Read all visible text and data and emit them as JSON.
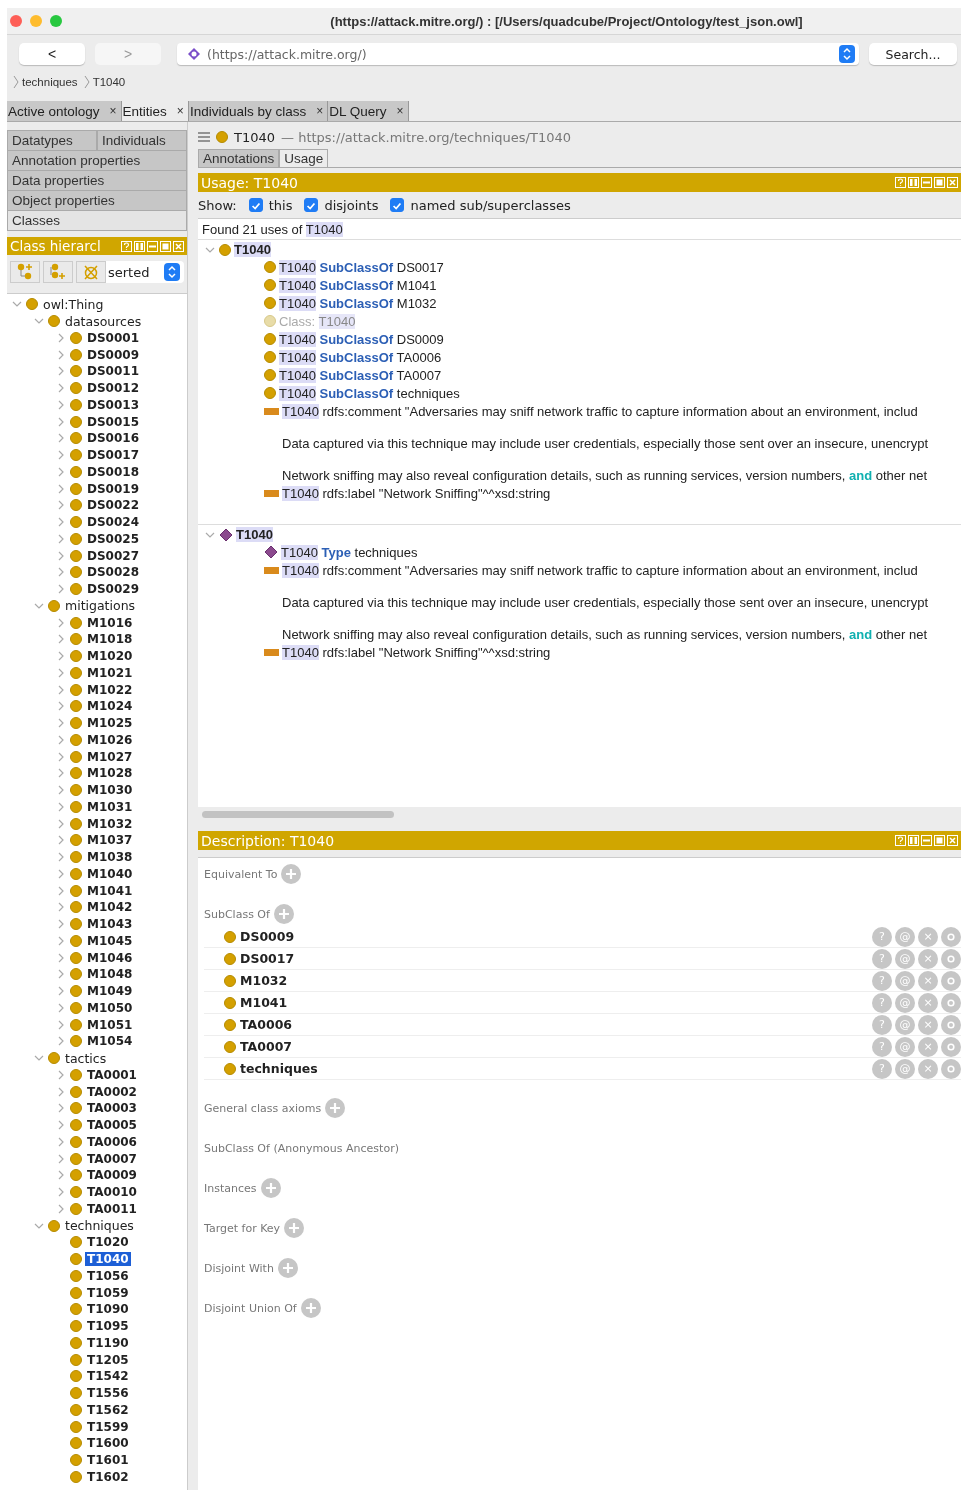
{
  "window": {
    "title": "(https://attack.mitre.org/)  : [/Users/quadcube/Project/Ontology/test_json.owl]"
  },
  "toolbar": {
    "back": "<",
    "forward": ">",
    "forward_disabled": true,
    "address": "(https://attack.mitre.org/)",
    "search": "Search..."
  },
  "breadcrumb": [
    "techniques",
    "T1040"
  ],
  "tabs": [
    {
      "label": "Active ontology",
      "close": "×",
      "selected": false
    },
    {
      "label": "Entities",
      "close": "×",
      "selected": true
    },
    {
      "label": "Individuals by class",
      "close": "×",
      "selected": false
    },
    {
      "label": "DL Query",
      "close": "×",
      "selected": false
    }
  ],
  "entity_tabs": [
    {
      "label": "Datatypes",
      "selected": false
    },
    {
      "label": "Individuals",
      "selected": false
    },
    {
      "label": "Annotation properties",
      "selected": false
    },
    {
      "label": "Data properties",
      "selected": false
    },
    {
      "label": "Object properties",
      "selected": false
    },
    {
      "label": "Classes",
      "selected": true
    }
  ],
  "class_hierarchy": {
    "title": "Class hierarcl",
    "mode": "serted",
    "tree": [
      {
        "label": "owl:Thing",
        "kind": "branch",
        "expanded": true,
        "selected": false,
        "children": [
          {
            "label": "datasources",
            "kind": "branch",
            "expanded": true,
            "selected": false,
            "children": [
              {
                "label": "DS0001",
                "kind": "branch",
                "expanded": false,
                "selected": false
              },
              {
                "label": "DS0009",
                "kind": "branch",
                "expanded": false,
                "selected": false
              },
              {
                "label": "DS0011",
                "kind": "branch",
                "expanded": false,
                "selected": false
              },
              {
                "label": "DS0012",
                "kind": "branch",
                "expanded": false,
                "selected": false
              },
              {
                "label": "DS0013",
                "kind": "branch",
                "expanded": false,
                "selected": false
              },
              {
                "label": "DS0015",
                "kind": "branch",
                "expanded": false,
                "selected": false
              },
              {
                "label": "DS0016",
                "kind": "branch",
                "expanded": false,
                "selected": false
              },
              {
                "label": "DS0017",
                "kind": "branch",
                "expanded": false,
                "selected": false
              },
              {
                "label": "DS0018",
                "kind": "branch",
                "expanded": false,
                "selected": false
              },
              {
                "label": "DS0019",
                "kind": "branch",
                "expanded": false,
                "selected": false
              },
              {
                "label": "DS0022",
                "kind": "branch",
                "expanded": false,
                "selected": false
              },
              {
                "label": "DS0024",
                "kind": "branch",
                "expanded": false,
                "selected": false
              },
              {
                "label": "DS0025",
                "kind": "branch",
                "expanded": false,
                "selected": false
              },
              {
                "label": "DS0027",
                "kind": "branch",
                "expanded": false,
                "selected": false
              },
              {
                "label": "DS0028",
                "kind": "branch",
                "expanded": false,
                "selected": false
              },
              {
                "label": "DS0029",
                "kind": "branch",
                "expanded": false,
                "selected": false
              }
            ]
          },
          {
            "label": "mitigations",
            "kind": "branch",
            "expanded": true,
            "selected": false,
            "children": [
              {
                "label": "M1016",
                "kind": "branch",
                "expanded": false,
                "selected": false
              },
              {
                "label": "M1018",
                "kind": "branch",
                "expanded": false,
                "selected": false
              },
              {
                "label": "M1020",
                "kind": "branch",
                "expanded": false,
                "selected": false
              },
              {
                "label": "M1021",
                "kind": "branch",
                "expanded": false,
                "selected": false
              },
              {
                "label": "M1022",
                "kind": "branch",
                "expanded": false,
                "selected": false
              },
              {
                "label": "M1024",
                "kind": "branch",
                "expanded": false,
                "selected": false
              },
              {
                "label": "M1025",
                "kind": "branch",
                "expanded": false,
                "selected": false
              },
              {
                "label": "M1026",
                "kind": "branch",
                "expanded": false,
                "selected": false
              },
              {
                "label": "M1027",
                "kind": "branch",
                "expanded": false,
                "selected": false
              },
              {
                "label": "M1028",
                "kind": "branch",
                "expanded": false,
                "selected": false
              },
              {
                "label": "M1030",
                "kind": "branch",
                "expanded": false,
                "selected": false
              },
              {
                "label": "M1031",
                "kind": "branch",
                "expanded": false,
                "selected": false
              },
              {
                "label": "M1032",
                "kind": "branch",
                "expanded": false,
                "selected": false
              },
              {
                "label": "M1037",
                "kind": "branch",
                "expanded": false,
                "selected": false
              },
              {
                "label": "M1038",
                "kind": "branch",
                "expanded": false,
                "selected": false
              },
              {
                "label": "M1040",
                "kind": "branch",
                "expanded": false,
                "selected": false
              },
              {
                "label": "M1041",
                "kind": "branch",
                "expanded": false,
                "selected": false
              },
              {
                "label": "M1042",
                "kind": "branch",
                "expanded": false,
                "selected": false
              },
              {
                "label": "M1043",
                "kind": "branch",
                "expanded": false,
                "selected": false
              },
              {
                "label": "M1045",
                "kind": "branch",
                "expanded": false,
                "selected": false
              },
              {
                "label": "M1046",
                "kind": "branch",
                "expanded": false,
                "selected": false
              },
              {
                "label": "M1048",
                "kind": "branch",
                "expanded": false,
                "selected": false
              },
              {
                "label": "M1049",
                "kind": "branch",
                "expanded": false,
                "selected": false
              },
              {
                "label": "M1050",
                "kind": "branch",
                "expanded": false,
                "selected": false
              },
              {
                "label": "M1051",
                "kind": "branch",
                "expanded": false,
                "selected": false
              },
              {
                "label": "M1054",
                "kind": "branch",
                "expanded": false,
                "selected": false
              }
            ]
          },
          {
            "label": "tactics",
            "kind": "branch",
            "expanded": true,
            "selected": false,
            "children": [
              {
                "label": "TA0001",
                "kind": "branch",
                "expanded": false,
                "selected": false
              },
              {
                "label": "TA0002",
                "kind": "branch",
                "expanded": false,
                "selected": false
              },
              {
                "label": "TA0003",
                "kind": "branch",
                "expanded": false,
                "selected": false
              },
              {
                "label": "TA0005",
                "kind": "branch",
                "expanded": false,
                "selected": false
              },
              {
                "label": "TA0006",
                "kind": "branch",
                "expanded": false,
                "selected": false
              },
              {
                "label": "TA0007",
                "kind": "branch",
                "expanded": false,
                "selected": false
              },
              {
                "label": "TA0009",
                "kind": "branch",
                "expanded": false,
                "selected": false
              },
              {
                "label": "TA0010",
                "kind": "branch",
                "expanded": false,
                "selected": false
              },
              {
                "label": "TA0011",
                "kind": "branch",
                "expanded": false,
                "selected": false
              }
            ]
          },
          {
            "label": "techniques",
            "kind": "branch",
            "expanded": true,
            "selected": false,
            "children": [
              {
                "label": "T1020",
                "kind": "leaf",
                "selected": false
              },
              {
                "label": "T1040",
                "kind": "leaf",
                "selected": true
              },
              {
                "label": "T1056",
                "kind": "leaf",
                "selected": false
              },
              {
                "label": "T1059",
                "kind": "leaf",
                "selected": false
              },
              {
                "label": "T1090",
                "kind": "leaf",
                "selected": false
              },
              {
                "label": "T1095",
                "kind": "leaf",
                "selected": false
              },
              {
                "label": "T1190",
                "kind": "leaf",
                "selected": false
              },
              {
                "label": "T1205",
                "kind": "leaf",
                "selected": false
              },
              {
                "label": "T1542",
                "kind": "leaf",
                "selected": false
              },
              {
                "label": "T1556",
                "kind": "leaf",
                "selected": false
              },
              {
                "label": "T1562",
                "kind": "leaf",
                "selected": false
              },
              {
                "label": "T1599",
                "kind": "leaf",
                "selected": false
              },
              {
                "label": "T1600",
                "kind": "leaf",
                "selected": false
              },
              {
                "label": "T1601",
                "kind": "leaf",
                "selected": false
              },
              {
                "label": "T1602",
                "kind": "leaf",
                "selected": false
              }
            ]
          }
        ]
      }
    ]
  },
  "entity_header": {
    "name": "T1040",
    "iri": "— https://attack.mitre.org/techniques/T1040"
  },
  "view_tabs": [
    {
      "label": "Annotations",
      "selected": false
    },
    {
      "label": "Usage",
      "selected": true
    }
  ],
  "usage": {
    "title": "Usage: T1040",
    "show_label": "Show:",
    "filters": [
      {
        "label": "this",
        "checked": true
      },
      {
        "label": "disjoints",
        "checked": true
      },
      {
        "label": "named sub/superclasses",
        "checked": true
      }
    ],
    "summary": [
      {
        "text": "Found 21 uses of",
        "kind": "plain"
      },
      {
        "text": "T1040",
        "kind": "subject"
      }
    ],
    "groups": [
      {
        "expanded": true,
        "kind": "class",
        "label": "T1040",
        "items": [
          {
            "kind": "class",
            "parts": [
              {
                "text": "T1040",
                "kind": "subject"
              },
              {
                "text": "SubClassOf",
                "kind": "keyword"
              },
              {
                "text": "DS0017",
                "kind": "plain"
              }
            ]
          },
          {
            "kind": "class",
            "parts": [
              {
                "text": "T1040",
                "kind": "subject"
              },
              {
                "text": "SubClassOf",
                "kind": "keyword"
              },
              {
                "text": "M1041",
                "kind": "plain"
              }
            ]
          },
          {
            "kind": "class",
            "parts": [
              {
                "text": "T1040",
                "kind": "subject"
              },
              {
                "text": "SubClassOf",
                "kind": "keyword"
              },
              {
                "text": "M1032",
                "kind": "plain"
              }
            ]
          },
          {
            "kind": "declaration",
            "parts": [
              {
                "text": "Class:",
                "kind": "dim"
              },
              {
                "text": "T1040",
                "kind": "dim-subject"
              }
            ]
          },
          {
            "kind": "class",
            "parts": [
              {
                "text": "T1040",
                "kind": "subject"
              },
              {
                "text": "SubClassOf",
                "kind": "keyword"
              },
              {
                "text": "DS0009",
                "kind": "plain"
              }
            ]
          },
          {
            "kind": "class",
            "parts": [
              {
                "text": "T1040",
                "kind": "subject"
              },
              {
                "text": "SubClassOf",
                "kind": "keyword"
              },
              {
                "text": "TA0006",
                "kind": "plain"
              }
            ]
          },
          {
            "kind": "class",
            "parts": [
              {
                "text": "T1040",
                "kind": "subject"
              },
              {
                "text": "SubClassOf",
                "kind": "keyword"
              },
              {
                "text": "TA0007",
                "kind": "plain"
              }
            ]
          },
          {
            "kind": "class",
            "parts": [
              {
                "text": "T1040",
                "kind": "subject"
              },
              {
                "text": "SubClassOf",
                "kind": "keyword"
              },
              {
                "text": "techniques",
                "kind": "plain"
              }
            ]
          },
          {
            "kind": "annotation",
            "parts": [
              {
                "text": "T1040",
                "kind": "subject"
              },
              {
                "text": "rdfs:comment \"Adversaries may sniff network traffic to capture information about an environment, includ",
                "kind": "plain"
              }
            ],
            "more": [
              [
                {
                  "text": "Data captured via this technique may include user credentials, especially those sent over an insecure, unencrypt",
                  "kind": "plain"
                }
              ],
              [
                {
                  "text": "Network sniffing may also reveal configuration details, such as running services, version numbers,",
                  "kind": "plain"
                },
                {
                  "text": "and",
                  "kind": "teal"
                },
                {
                  "text": "other net",
                  "kind": "plain"
                }
              ]
            ]
          },
          {
            "kind": "annotation",
            "parts": [
              {
                "text": "T1040",
                "kind": "subject"
              },
              {
                "text": "rdfs:label \"Network Sniffing\"^^xsd:string",
                "kind": "plain"
              }
            ]
          }
        ]
      },
      {
        "expanded": true,
        "kind": "individual",
        "label": "T1040",
        "items": [
          {
            "kind": "individual",
            "parts": [
              {
                "text": "T1040",
                "kind": "subject"
              },
              {
                "text": "Type",
                "kind": "keyword"
              },
              {
                "text": "techniques",
                "kind": "plain"
              }
            ]
          },
          {
            "kind": "annotation",
            "parts": [
              {
                "text": "T1040",
                "kind": "subject"
              },
              {
                "text": "rdfs:comment \"Adversaries may sniff network traffic to capture information about an environment, includ",
                "kind": "plain"
              }
            ],
            "more": [
              [
                {
                  "text": "Data captured via this technique may include user credentials, especially those sent over an insecure, unencrypt",
                  "kind": "plain"
                }
              ],
              [
                {
                  "text": "Network sniffing may also reveal configuration details, such as running services, version numbers,",
                  "kind": "plain"
                },
                {
                  "text": "and",
                  "kind": "teal"
                },
                {
                  "text": "other net",
                  "kind": "plain"
                }
              ]
            ]
          },
          {
            "kind": "annotation",
            "parts": [
              {
                "text": "T1040",
                "kind": "subject"
              },
              {
                "text": "rdfs:label \"Network Sniffing\"^^xsd:string",
                "kind": "plain"
              }
            ]
          }
        ]
      }
    ]
  },
  "description": {
    "title": "Description: T1040",
    "sections": [
      {
        "label": "Equivalent To",
        "addable": true
      },
      {
        "label": "SubClass Of",
        "addable": true,
        "rows": [
          {
            "label": "DS0009",
            "buttons": [
              "?",
              "@",
              "×"
            ]
          },
          {
            "label": "DS0017",
            "buttons": [
              "?",
              "@",
              "×"
            ]
          },
          {
            "label": "M1032",
            "buttons": [
              "?",
              "@",
              "×"
            ]
          },
          {
            "label": "M1041",
            "buttons": [
              "?",
              "@",
              "×"
            ]
          },
          {
            "label": "TA0006",
            "buttons": [
              "?",
              "@",
              "×"
            ]
          },
          {
            "label": "TA0007",
            "buttons": [
              "?",
              "@",
              "×"
            ]
          },
          {
            "label": "techniques",
            "buttons": [
              "?",
              "@",
              "×"
            ]
          }
        ]
      },
      {
        "label": "General class axioms",
        "addable": true
      },
      {
        "label": "SubClass Of (Anonymous Ancestor)",
        "addable": false
      },
      {
        "label": "Instances",
        "addable": true
      },
      {
        "label": "Target for Key",
        "addable": true
      },
      {
        "label": "Disjoint With",
        "addable": true
      },
      {
        "label": "Disjoint Union Of",
        "addable": true
      }
    ]
  }
}
